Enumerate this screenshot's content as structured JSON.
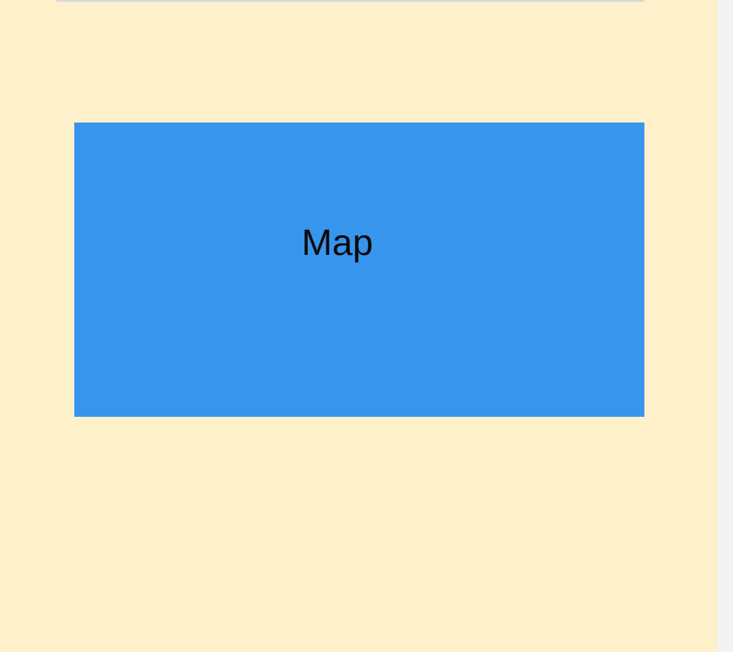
{
  "map": {
    "label": "Map"
  }
}
